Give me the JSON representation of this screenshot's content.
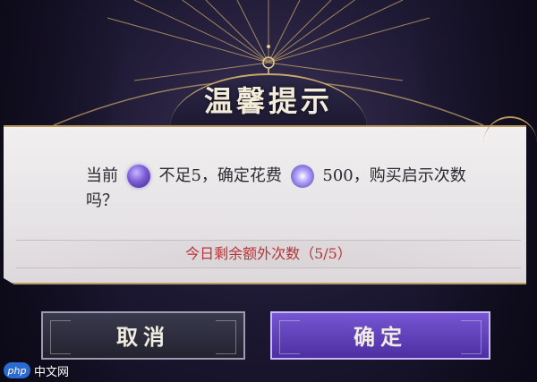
{
  "dialog": {
    "title": "温馨提示",
    "message": {
      "prefix": "当前",
      "middle": "不足5，确定花费",
      "amount": "500，购买启示次数",
      "line2": "吗？"
    },
    "remaining_text": "今日剩余额外次数（5/5）",
    "cancel_label": "取消",
    "confirm_label": "确定"
  },
  "watermark": {
    "logo_text": "php",
    "site_text": "中文网"
  },
  "colors": {
    "accent_gold": "#c9a86a",
    "warning_red": "#b6343a",
    "confirm_purple": "#6a4bc4"
  },
  "icons": {
    "currency": "purple-gem-icon",
    "star": "star-crystal-icon"
  }
}
